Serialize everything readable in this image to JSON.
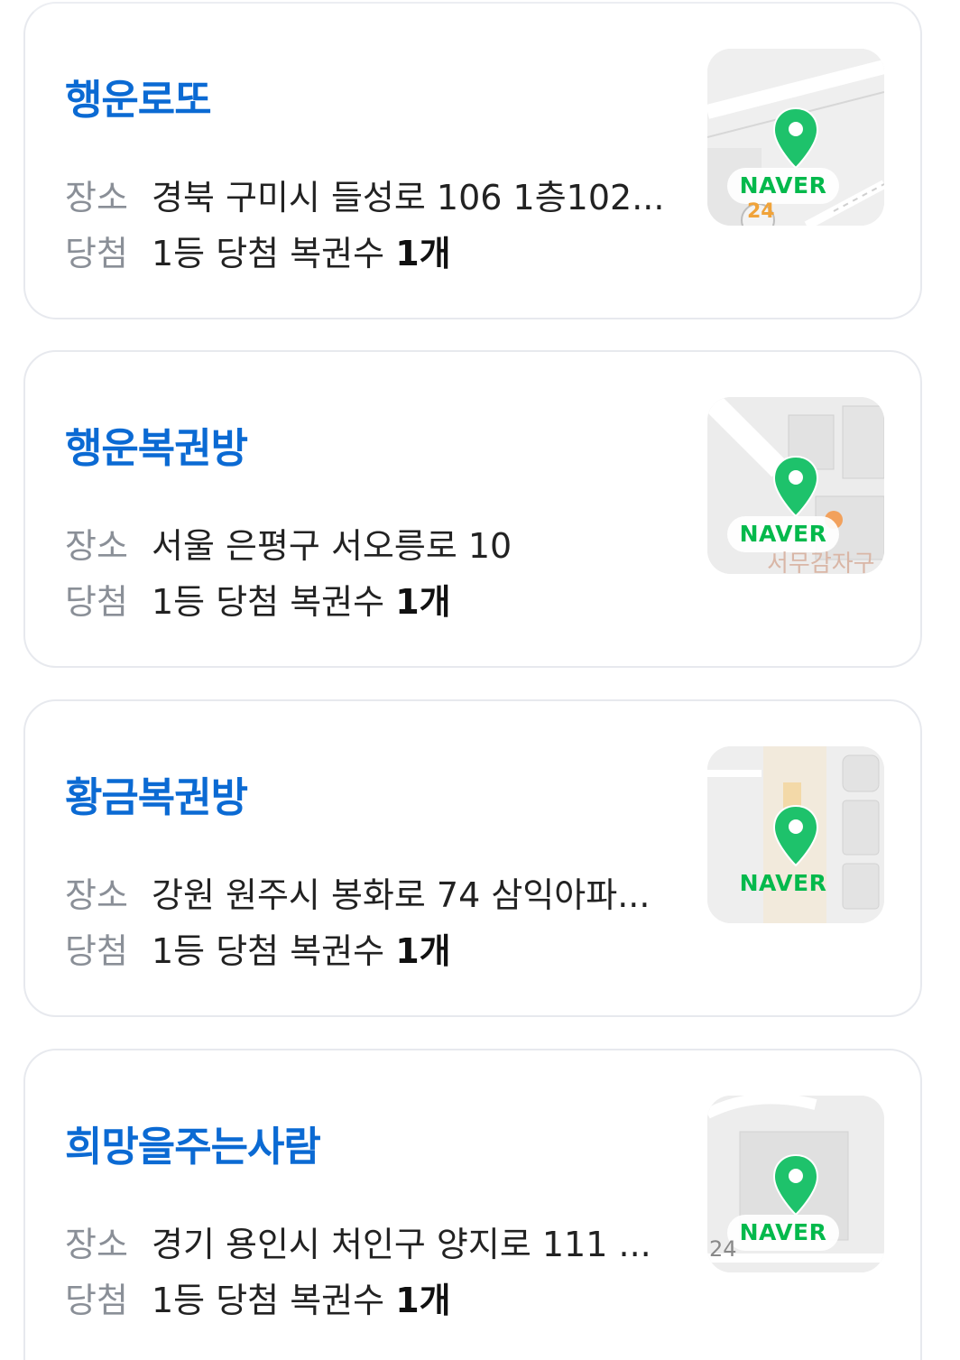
{
  "cards": [
    {
      "name": "행운로또",
      "place_label": "장소",
      "place_value": "경북 구미시 들성로 106 1층102...",
      "win_label": "당첨",
      "win_text": "1등 당첨 복권수",
      "win_count": "1개",
      "map_badge": "NAVER",
      "map_caption": "24"
    },
    {
      "name": "행운복권방",
      "place_label": "장소",
      "place_value": "서울 은평구 서오릉로 10",
      "win_label": "당첨",
      "win_text": "1등 당첨 복권수",
      "win_count": "1개",
      "map_badge": "NAVER",
      "map_caption": "서무감자구"
    },
    {
      "name": "황금복권방",
      "place_label": "장소",
      "place_value": "강원 원주시 봉화로 74 삼익아파...",
      "win_label": "당첨",
      "win_text": "1등 당첨 복권수",
      "win_count": "1개",
      "map_badge": "NAVER",
      "map_caption": ""
    },
    {
      "name": "희망을주는사람",
      "place_label": "장소",
      "place_value": "경기 용인시 처인구 양지로 111 ...",
      "win_label": "당첨",
      "win_text": "1등 당첨 복권수",
      "win_count": "1개",
      "map_badge": "NAVER",
      "map_caption": "24"
    }
  ],
  "colors": {
    "store_name": "#0b6ad3",
    "label": "#8a8f97",
    "naver_green": "#03b94c",
    "card_border": "#e7e9ee"
  },
  "icons": {
    "map_pin": "map-pin-icon"
  }
}
